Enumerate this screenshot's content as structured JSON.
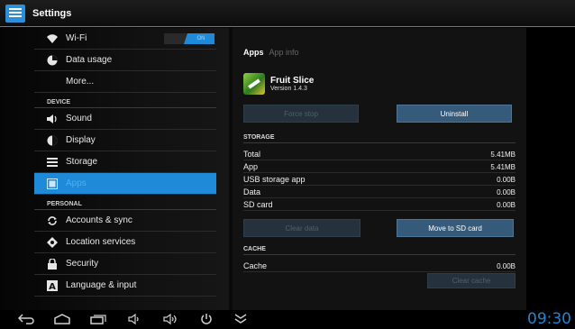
{
  "titlebar": {
    "title": "Settings"
  },
  "left": {
    "items": [
      {
        "label": "Wi-Fi",
        "icon": "wifi-icon",
        "toggle": "ON"
      },
      {
        "label": "Data usage",
        "icon": "data-usage-icon"
      },
      {
        "label": "More..."
      }
    ],
    "device_header": "DEVICE",
    "device_items": [
      {
        "label": "Sound",
        "icon": "speaker-icon"
      },
      {
        "label": "Display",
        "icon": "brightness-icon"
      },
      {
        "label": "Storage",
        "icon": "storage-icon"
      },
      {
        "label": "Apps",
        "icon": "apps-icon",
        "selected": true
      }
    ],
    "personal_header": "PERSONAL",
    "personal_items": [
      {
        "label": "Accounts & sync",
        "icon": "sync-icon"
      },
      {
        "label": "Location services",
        "icon": "location-icon"
      },
      {
        "label": "Security",
        "icon": "lock-icon"
      },
      {
        "label": "Language & input",
        "icon": "keyboard-icon"
      }
    ]
  },
  "right": {
    "tabs": {
      "active": "Apps",
      "inactive": "App info"
    },
    "app": {
      "name": "Fruit Slice",
      "version": "Version 1.4.3"
    },
    "buttons": {
      "force_stop": "Force stop",
      "uninstall": "Uninstall",
      "clear_data": "Clear data",
      "move_sd": "Move to SD card",
      "clear_cache": "Clear cache"
    },
    "storage_header": "STORAGE",
    "storage_rows": [
      {
        "label": "Total",
        "value": "5.41MB"
      },
      {
        "label": "App",
        "value": "5.41MB"
      },
      {
        "label": "USB storage app",
        "value": "0.00B"
      },
      {
        "label": "Data",
        "value": "0.00B"
      },
      {
        "label": "SD card",
        "value": "0.00B"
      }
    ],
    "cache_header": "CACHE",
    "cache_row": {
      "label": "Cache",
      "value": "0.00B"
    }
  },
  "navbar": {
    "clock": "09:30"
  },
  "colors": {
    "accent": "#1e8ad8",
    "button": "#365a79",
    "disabled_button": "#25323d"
  }
}
